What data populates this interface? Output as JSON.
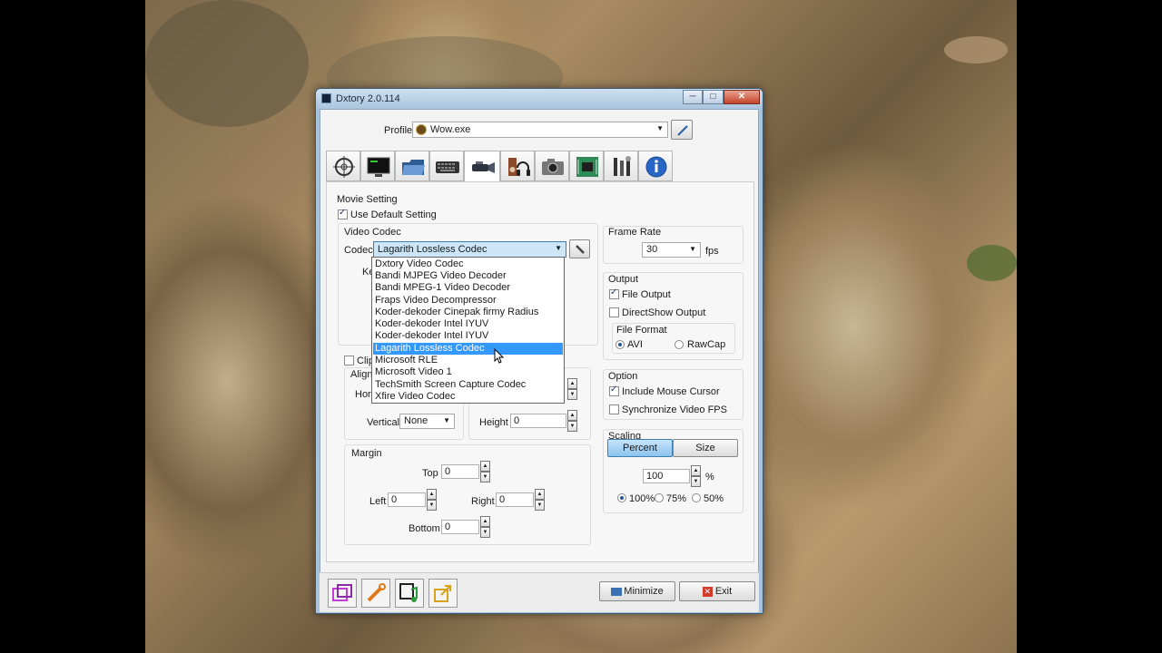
{
  "window": {
    "title": "Dxtory 2.0.114",
    "min_label": "─",
    "max_label": "□",
    "close_label": "✕"
  },
  "profile": {
    "label": "Profile",
    "value": "Wow.exe"
  },
  "tabs": [
    {
      "icon": "crosshair-icon"
    },
    {
      "icon": "monitor-icon"
    },
    {
      "icon": "folder-icon"
    },
    {
      "icon": "keyboard-icon"
    },
    {
      "icon": "video-camera-icon",
      "active": true
    },
    {
      "icon": "audio-icon"
    },
    {
      "icon": "camera-icon"
    },
    {
      "icon": "chip-icon"
    },
    {
      "icon": "tools-icon"
    },
    {
      "icon": "info-icon"
    }
  ],
  "movie": {
    "section_label": "Movie Setting",
    "use_default_label": "Use Default Setting",
    "use_default_checked": true,
    "video_codec_label": "Video Codec",
    "codec_label": "Codec",
    "codec_value": "Lagarith Lossless Codec",
    "codec_options": [
      "Dxtory Video Codec",
      "Bandi MJPEG Video Decoder",
      "Bandi MPEG-1 Video Decoder",
      "Fraps Video Decompressor",
      "Koder-dekoder Cinepak firmy Radius",
      "Koder-dekoder Intel IYUV",
      "Koder-dekoder Intel IYUV",
      "Lagarith Lossless Codec",
      "Microsoft RLE",
      "Microsoft Video 1",
      "TechSmith Screen Capture Codec",
      "Xfire Video Codec"
    ],
    "codec_selected_index": 7,
    "partial_ke": "Ke",
    "clip_label": "Clip",
    "align_label": "Align",
    "horiz_partial": "Hori",
    "vertical_label": "Vertical",
    "vertical_value": "None",
    "height_label": "Height",
    "height_value": "0",
    "margin_label": "Margin",
    "top_label": "Top",
    "top_value": "0",
    "left_label": "Left",
    "left_value": "0",
    "right_label": "Right",
    "right_value": "0",
    "bottom_label": "Bottom",
    "bottom_value": "0"
  },
  "frame_rate": {
    "label": "Frame Rate",
    "value": "30",
    "unit": "fps"
  },
  "output": {
    "label": "Output",
    "file_output": "File Output",
    "file_output_checked": true,
    "directshow": "DirectShow Output",
    "directshow_checked": false,
    "file_format_label": "File Format",
    "avi": "AVI",
    "rawcap": "RawCap",
    "avi_selected": true
  },
  "option": {
    "label": "Option",
    "mouse_cursor": "Include Mouse Cursor",
    "mouse_cursor_checked": true,
    "sync_fps": "Synchronize Video FPS",
    "sync_fps_checked": false
  },
  "scaling": {
    "label": "Scaling",
    "percent": "Percent",
    "size": "Size",
    "value": "100",
    "unit": "%",
    "r100": "100%",
    "r75": "75%",
    "r50": "50%"
  },
  "footer": {
    "minimize": "Minimize",
    "exit": "Exit"
  },
  "colors": {
    "selection": "#3399ff",
    "title_bar": "#a9c5de",
    "percent_active": "#9fc8ef"
  }
}
